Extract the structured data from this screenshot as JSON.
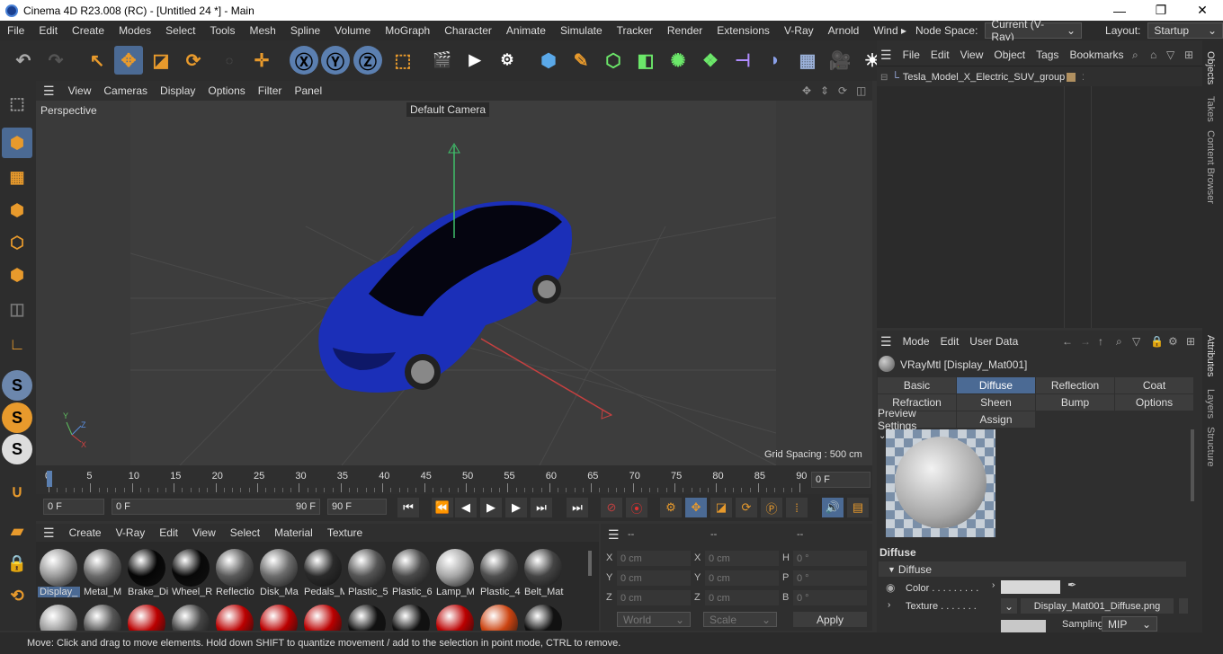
{
  "window": {
    "title": "Cinema 4D R23.008 (RC) - [Untitled 24 *] - Main",
    "min": "—",
    "max": "❐",
    "close": "✕"
  },
  "menubar": {
    "items": [
      "File",
      "Edit",
      "Create",
      "Modes",
      "Select",
      "Tools",
      "Mesh",
      "Spline",
      "Volume",
      "MoGraph",
      "Character",
      "Animate",
      "Simulate",
      "Tracker",
      "Render",
      "Extensions",
      "V-Ray",
      "Arnold",
      "Wind ▸"
    ],
    "node_space_label": "Node Space:",
    "node_space_value": "Current (V-Ray)",
    "layout_label": "Layout:",
    "layout_value": "Startup"
  },
  "viewport": {
    "menu": [
      "View",
      "Cameras",
      "Display",
      "Options",
      "Filter",
      "Panel"
    ],
    "view_name": "Perspective",
    "camera_label": "Default Camera",
    "grid_spacing": "Grid Spacing : 500 cm",
    "axis_y": "Y",
    "axis_z": "Z",
    "axis_x": "X"
  },
  "timeline": {
    "ticks": [
      "0",
      "5",
      "10",
      "15",
      "20",
      "25",
      "30",
      "35",
      "40",
      "45",
      "50",
      "55",
      "60",
      "65",
      "70",
      "75",
      "80",
      "85",
      "90"
    ],
    "current_frame": "0 F",
    "start_field": "0 F",
    "range_start": "0 F",
    "range_end": "90 F",
    "end_field": "90 F"
  },
  "materials": {
    "menu": [
      "Create",
      "V-Ray",
      "Edit",
      "View",
      "Select",
      "Material",
      "Texture"
    ],
    "row1": [
      {
        "name": "Display_",
        "color": "#9a9a9a"
      },
      {
        "name": "Metal_M",
        "color": "#6a6a6a"
      },
      {
        "name": "Brake_Di",
        "color": "#050505"
      },
      {
        "name": "Wheel_R",
        "color": "#080808"
      },
      {
        "name": "Reflectio",
        "color": "#5a5a5a"
      },
      {
        "name": "Disk_Ma",
        "color": "#6c6c6c"
      },
      {
        "name": "Pedals_M",
        "color": "#2a2a2a"
      },
      {
        "name": "Plastic_5",
        "color": "#555"
      },
      {
        "name": "Plastic_6",
        "color": "#4a4a4a"
      },
      {
        "name": "Lamp_M",
        "color": "#a8a8a8"
      },
      {
        "name": "Plastic_4",
        "color": "#4f4f4f"
      },
      {
        "name": "Belt_Mat",
        "color": "#444"
      }
    ],
    "row2_colors": [
      "#999",
      "#555",
      "#b00",
      "#444",
      "#b00",
      "#b00",
      "#b00",
      "#111",
      "#111",
      "#b00",
      "#c41",
      "#111"
    ]
  },
  "coords": {
    "header": [
      "--",
      "--",
      "--"
    ],
    "rows": [
      {
        "a": "X",
        "av": "0 cm",
        "b": "X",
        "bv": "0 cm",
        "c": "H",
        "cv": "0 °"
      },
      {
        "a": "Y",
        "av": "0 cm",
        "b": "Y",
        "bv": "0 cm",
        "c": "P",
        "cv": "0 °"
      },
      {
        "a": "Z",
        "av": "0 cm",
        "b": "Z",
        "bv": "0 cm",
        "c": "B",
        "cv": "0 °"
      }
    ],
    "world": "World",
    "scale": "Scale",
    "apply": "Apply"
  },
  "objects": {
    "menu": [
      "File",
      "Edit",
      "View",
      "Object",
      "Tags",
      "Bookmarks"
    ],
    "item": "Tesla_Model_X_Electric_SUV_group"
  },
  "attributes": {
    "menu": [
      "Mode",
      "Edit",
      "User Data"
    ],
    "material_name": "VRayMtl [Display_Mat001]",
    "tabs_row1": [
      "Basic",
      "Diffuse",
      "Reflection",
      "Coat"
    ],
    "tabs_row2": [
      "Refraction",
      "Sheen",
      "Bump",
      "Options"
    ],
    "tabs_row3": [
      "Preview Settings",
      "Assign"
    ],
    "section": "Diffuse",
    "subsection": "Diffuse",
    "color_label": "Color . . . . . . . . .",
    "texture_label": "Texture . . . . . . .",
    "texture_file": "Display_Mat001_Diffuse.png",
    "sampling_label": "Sampling",
    "sampling_value": "MIP",
    "color_swatch": "#d8d8d8"
  },
  "sidetabs": [
    "Objects",
    "Takes",
    "Content Browser",
    "Attributes",
    "Layers",
    "Structure"
  ],
  "status": "Move: Click and drag to move elements. Hold down SHIFT to quantize movement / add to the selection in point mode, CTRL to remove.",
  "colors": {
    "accent": "#4b6a94",
    "orange": "#e89a2c",
    "car": "#1b2fb8"
  }
}
